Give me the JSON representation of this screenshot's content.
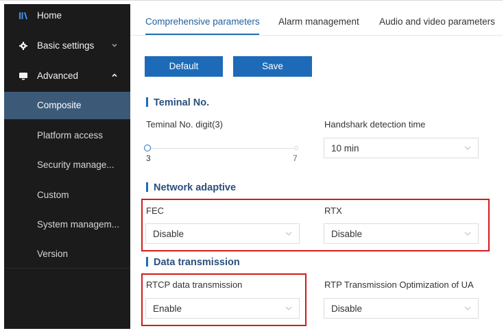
{
  "sidebar": {
    "top_items": [
      {
        "label": "Home",
        "icon": "home-bars-icon"
      },
      {
        "label": "Basic settings",
        "icon": "gear-icon",
        "chevron": "chevron-down-icon"
      },
      {
        "label": "Advanced",
        "icon": "monitor-icon",
        "chevron": "chevron-up-icon"
      }
    ],
    "sub_items": [
      {
        "label": "Composite",
        "active": true
      },
      {
        "label": "Platform access"
      },
      {
        "label": "Security manage..."
      },
      {
        "label": "Custom"
      },
      {
        "label": "System managem..."
      },
      {
        "label": "Version"
      }
    ]
  },
  "tabs": [
    {
      "label": "Comprehensive parameters",
      "active": true
    },
    {
      "label": "Alarm management"
    },
    {
      "label": "Audio and video parameters"
    }
  ],
  "toolbar": {
    "default_label": "Default",
    "save_label": "Save"
  },
  "sections": {
    "terminal": {
      "title": "Teminal No.",
      "digit_label": "Teminal No. digit(3)",
      "slider_min": "3",
      "slider_max": "7",
      "slider_value": 3,
      "handshake_label": "Handshark detection time",
      "handshake_value": "10 min"
    },
    "network": {
      "title": "Network adaptive",
      "fec_label": "FEC",
      "fec_value": "Disable",
      "rtx_label": "RTX",
      "rtx_value": "Disable"
    },
    "data": {
      "title": "Data transmission",
      "rtcp_label": "RTCP data transmission",
      "rtcp_value": "Enable",
      "rtp_label": "RTP Transmission Optimization of UA",
      "rtp_value": "Disable"
    }
  },
  "colors": {
    "sidebar_bg": "#1b1b1b",
    "active_item_bg": "#3c5a78",
    "accent": "#1d6bb8",
    "section_title": "#2c4f7c",
    "highlight_box": "#d31a1a"
  }
}
